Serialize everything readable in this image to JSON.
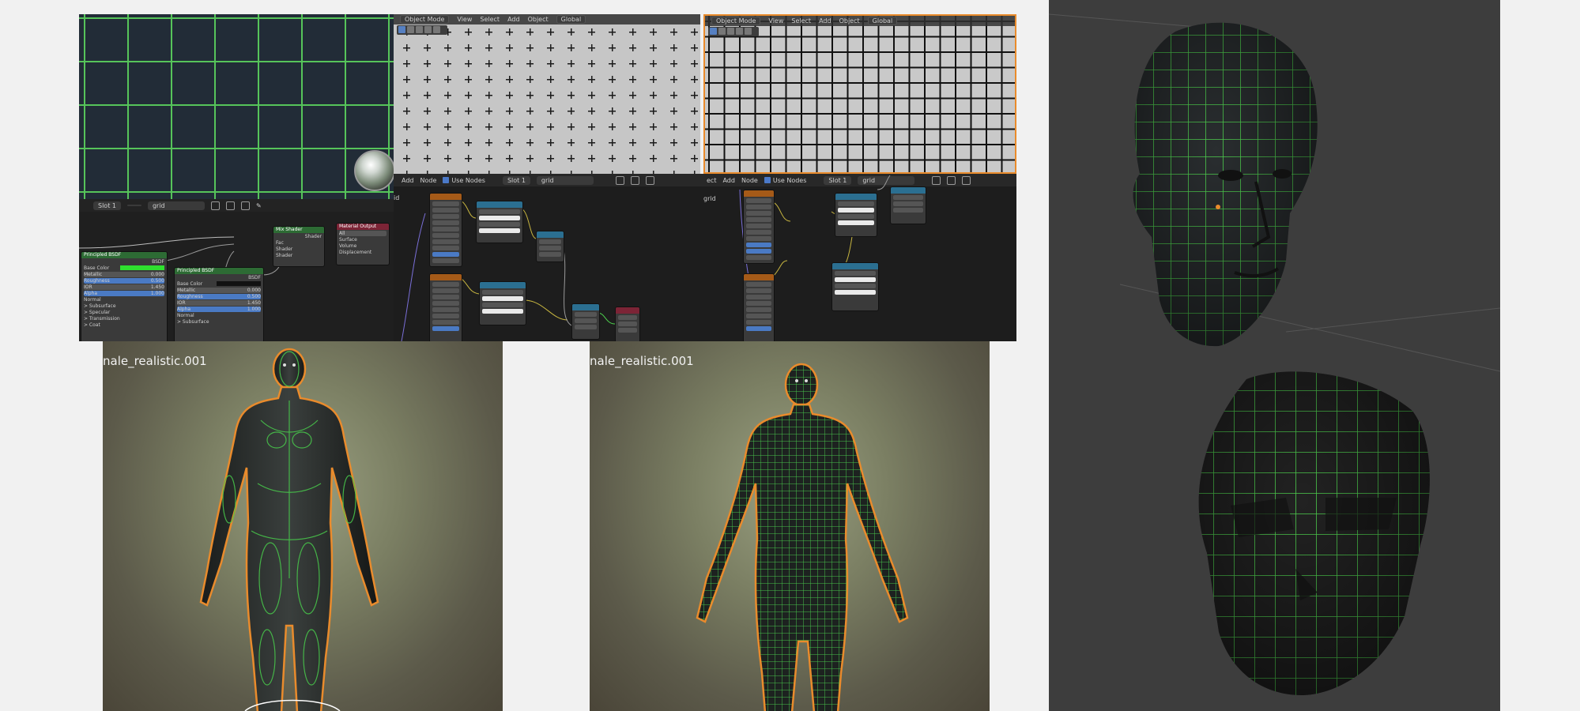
{
  "viewport_toolbar": {
    "mode": "Object Mode",
    "menus": [
      "View",
      "Select",
      "Add",
      "Object"
    ],
    "orientation": "Global"
  },
  "node_editor": {
    "left": {
      "slot": "Slot 1",
      "material": "grid",
      "nodes": {
        "principled_a": "Principled BSDF",
        "principled_b": "Principled BSDF",
        "mix": "Mix Shader",
        "output": "Material Output",
        "output_target": "All",
        "output_sockets": [
          "Surface",
          "Volume",
          "Displacement"
        ],
        "mix_sockets": [
          "Fac",
          "Shader",
          "Shader"
        ],
        "bsdf_out": "BSDF",
        "shader_out": "Shader",
        "principled_a_rows": [
          "Base Color",
          "Metallic",
          "Roughness",
          "IOR",
          "Alpha",
          "Normal",
          "> Subsurface",
          "> Specular",
          "> Transmission",
          "> Coat"
        ],
        "principled_a_values": [
          "",
          "0.000",
          "0.500",
          "1.450",
          "1.000"
        ],
        "principled_b_rows": [
          "Base Color",
          "Metallic",
          "Roughness",
          "IOR",
          "Alpha",
          "Normal",
          "> Subsurface"
        ],
        "principled_b_values": [
          "",
          "0.000",
          "0.500",
          "1.450",
          "1.000"
        ]
      }
    },
    "mid": {
      "header": [
        "Add",
        "Node"
      ],
      "use_nodes": "Use Nodes",
      "slot": "Slot 1",
      "material": "grid",
      "fragment": "id"
    },
    "right": {
      "header": [
        "ect",
        "Add",
        "Node"
      ],
      "use_nodes": "Use Nodes",
      "slot": "Slot 1",
      "material": "grid",
      "fragment": "grid"
    }
  },
  "bodies": {
    "left_label": "nale_realistic.001",
    "right_label": "nale_realistic.001"
  },
  "colors": {
    "grid_green": "#56c45a",
    "selection_orange": "#e98b2c",
    "viewport_dark": "#222c37",
    "head_bg": "#3d3d3d"
  }
}
